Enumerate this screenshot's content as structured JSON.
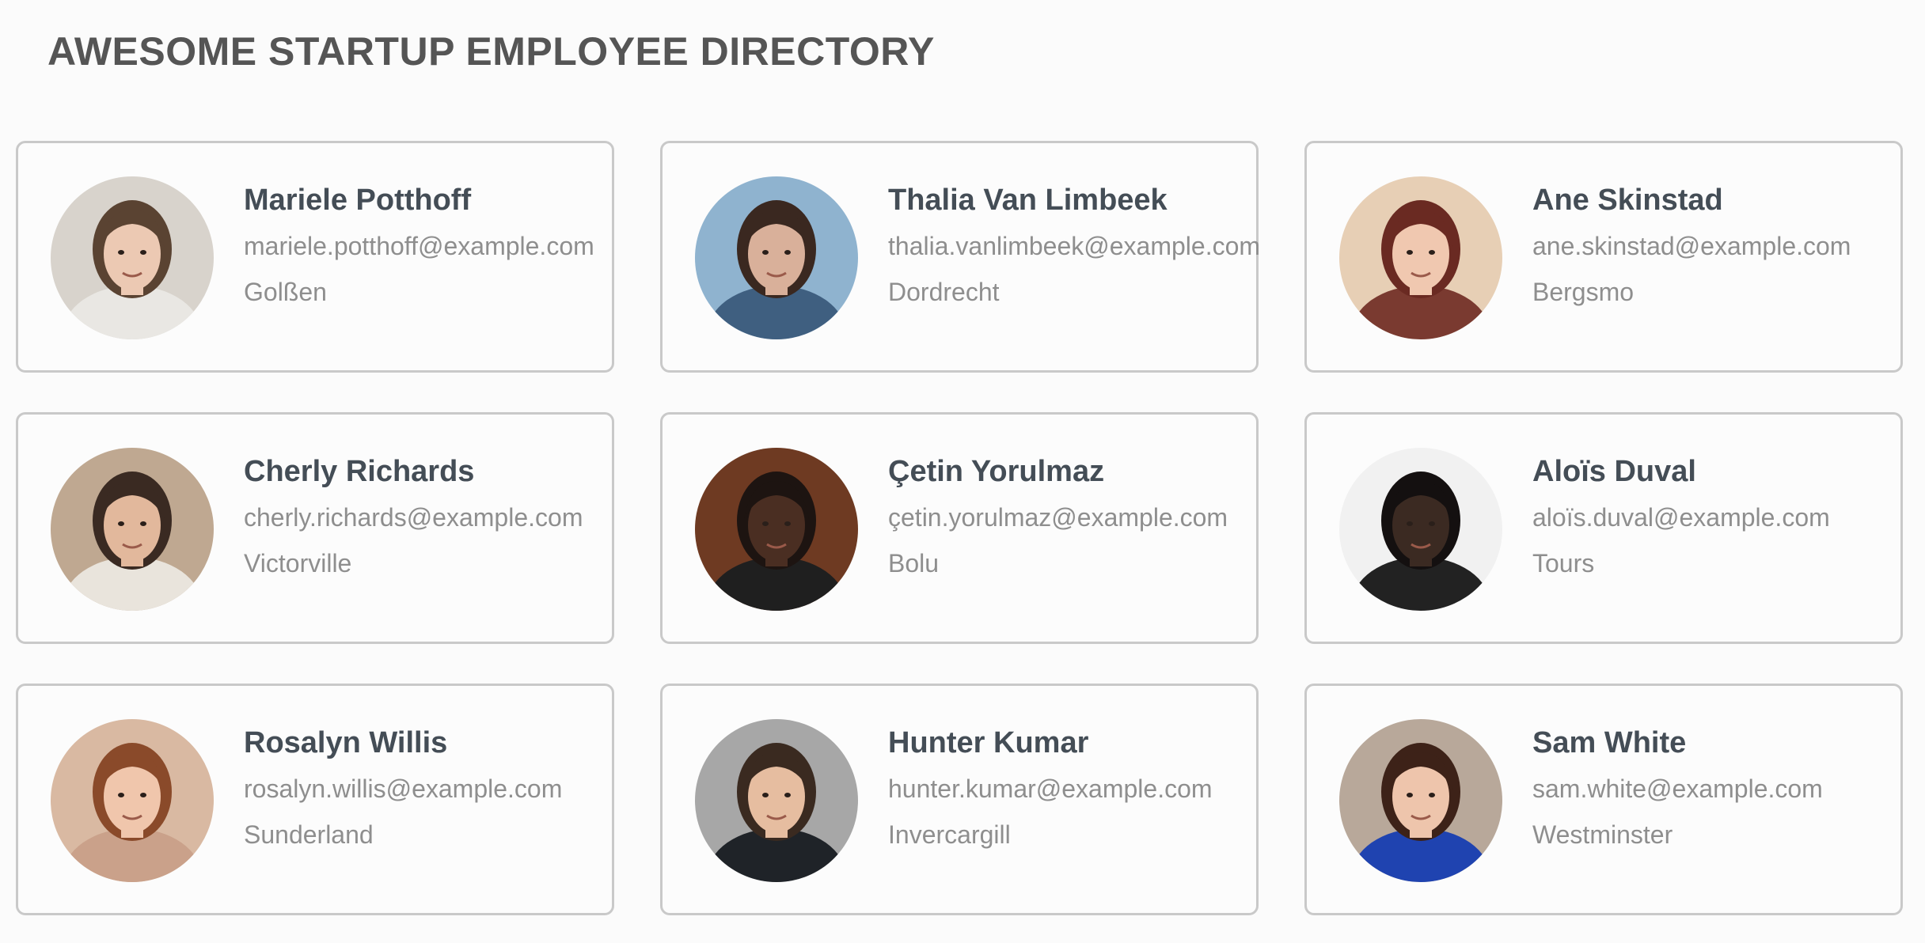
{
  "page": {
    "title": "AWESOME STARTUP EMPLOYEE DIRECTORY"
  },
  "employees": [
    {
      "name": "Mariele Potthoff",
      "email": "mariele.potthoff@example.com",
      "city": "Golßen",
      "avatar": {
        "bg": "#d8d3cc",
        "skin": "#ecc9b3",
        "hair": "#5a4332",
        "shirt": "#e9e7e3"
      }
    },
    {
      "name": "Thalia Van Limbeek",
      "email": "thalia.vanlimbeek@example.com",
      "city": "Dordrecht",
      "avatar": {
        "bg": "#8fb3cf",
        "skin": "#d9b09a",
        "hair": "#3a2820",
        "shirt": "#3f5f80"
      }
    },
    {
      "name": "Ane Skinstad",
      "email": "ane.skinstad@example.com",
      "city": "Bergsmo",
      "avatar": {
        "bg": "#e7cfb5",
        "skin": "#f0c8b0",
        "hair": "#6a2a22",
        "shirt": "#7a3a30"
      }
    },
    {
      "name": "Cherly Richards",
      "email": "cherly.richards@example.com",
      "city": "Victorville",
      "avatar": {
        "bg": "#bfa891",
        "skin": "#e2b89c",
        "hair": "#3a2a22",
        "shirt": "#e9e4dc"
      }
    },
    {
      "name": "Çetin Yorulmaz",
      "email": "çetin.yorulmaz@example.com",
      "city": "Bolu",
      "avatar": {
        "bg": "#6e3a22",
        "skin": "#4a2e22",
        "hair": "#1d1411",
        "shirt": "#1f1f1f"
      }
    },
    {
      "name": "Aloïs Duval",
      "email": "aloïs.duval@example.com",
      "city": "Tours",
      "avatar": {
        "bg": "#f1f1f1",
        "skin": "#3b2a22",
        "hair": "#141010",
        "shirt": "#222222"
      }
    },
    {
      "name": "Rosalyn Willis",
      "email": "rosalyn.willis@example.com",
      "city": "Sunderland",
      "avatar": {
        "bg": "#d9b9a2",
        "skin": "#f0c6ac",
        "hair": "#8a4a2a",
        "shirt": "#caa18a"
      }
    },
    {
      "name": "Hunter Kumar",
      "email": "hunter.kumar@example.com",
      "city": "Invercargill",
      "avatar": {
        "bg": "#a7a7a7",
        "skin": "#e6bda0",
        "hair": "#3a2a20",
        "shirt": "#1f2328"
      }
    },
    {
      "name": "Sam White",
      "email": "sam.white@example.com",
      "city": "Westminster",
      "avatar": {
        "bg": "#b8a89a",
        "skin": "#eec5ac",
        "hair": "#3d2218",
        "shirt": "#1f43b0"
      }
    }
  ]
}
